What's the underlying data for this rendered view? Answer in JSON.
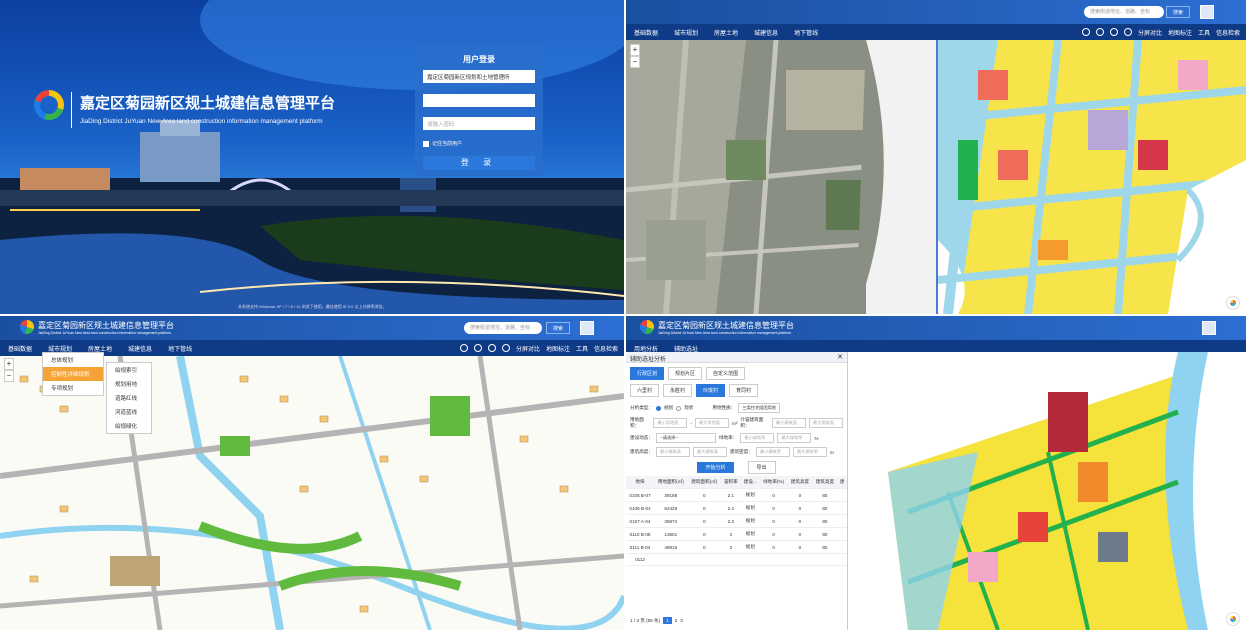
{
  "login": {
    "title_cn": "嘉定区菊园新区规土城建信息管理平台",
    "title_en": "JiaDing District JuYuan New Area land construction information management platform",
    "panel_title": "用户登录",
    "org_select": "嘉定区菊园新区规划和土地管理所",
    "user_select": "",
    "password_placeholder": "请输入密码",
    "remember": "记住当前用户",
    "login_button": "登 录",
    "footer": "本系统支持 Windows XP / 7 / 8 / 10 浏览下使用，最佳使用 IE 9.0 以上分辨率浏览。"
  },
  "app": {
    "title": "嘉定区菊园新区规土城建信息管理平台",
    "subtitle": "JiaDing District JuYuan New Area land construction information management platform",
    "search_placeholder": "搜索街道地址、道路、坐标",
    "search_button": "搜索",
    "menu": [
      "基础数据",
      "城市规划",
      "房屋土地",
      "城建信息",
      "地下管线"
    ],
    "right_menu": [
      "分屏对比",
      "地图标注",
      "工具",
      "信息检索"
    ],
    "q4_menu": [
      "用地分析",
      "辅助选址"
    ]
  },
  "dropdown": {
    "level1": [
      "总体规划",
      "控制性详细规划",
      "专项规划"
    ],
    "level2": [
      "绘规索引",
      "规划用地",
      "道路红线",
      "河道蓝线",
      "绘规绿化"
    ]
  },
  "panel": {
    "title": "辅助选址分析",
    "tabs1": [
      "行政区划",
      "规划片区",
      "自定义范围"
    ],
    "tabs2": [
      "六里村",
      "永胜村",
      "玲珑村",
      "育同村"
    ],
    "analysis_type_label": "分析类型：",
    "type_plan": "规划",
    "type_current": "现状",
    "land_use_label": "用地性质：",
    "land_use_value": "三类住宅组团用地",
    "area_label": "用地面积：",
    "min_area": "最小用地面",
    "max_area": "最大用地面",
    "unit_m2": "m²",
    "far_label": "计容建筑面积：",
    "min_far": "最小建筑面",
    "max_far": "最大建筑面",
    "status_label": "建设动态：",
    "status_value": "--请选择--",
    "green_label": "绿地率：",
    "min_green": "最小绿地率",
    "max_green": "最大绿地率",
    "pct": "%",
    "height_label": "建筑高度：",
    "min_height": "最小建筑高",
    "max_height": "最大建筑高",
    "density_label": "建筑密度：",
    "min_density": "最小建筑密",
    "max_density": "最大建筑密",
    "unit_m": "m",
    "start_button": "开始分析",
    "export_button": "导出",
    "columns": [
      "地块",
      "用地面积(㎡)",
      "建筑面积(㎡)",
      "容积率",
      "建设...",
      "绿地率(%)",
      "建筑高度",
      "建筑高度",
      "建"
    ],
    "rows": [
      [
        "0105 B-07",
        "39168",
        "0",
        "2.1",
        "规划",
        "0",
        "0",
        "80",
        ""
      ],
      [
        "0106 B-04",
        "62428",
        "0",
        "2.2",
        "规划",
        "0",
        "0",
        "80",
        ""
      ],
      [
        "0107 A-04",
        "35872",
        "0",
        "2.2",
        "规划",
        "0",
        "0",
        "80",
        ""
      ],
      [
        "0110 B-08",
        "13801",
        "0",
        "2",
        "规划",
        "0",
        "0",
        "80",
        ""
      ],
      [
        "0111 B-04",
        "48915",
        "0",
        "2",
        "规划",
        "0",
        "0",
        "80",
        ""
      ],
      [
        "0112",
        "",
        "",
        "",
        "",
        "",
        "",
        "",
        ""
      ]
    ],
    "pager": "1 / 3 页 (59 条)",
    "pages": [
      "1",
      "2",
      "3"
    ]
  },
  "colors": {
    "blue": "#2a78dc",
    "residential": "#f5e23a",
    "commercial": "#e8433a",
    "green": "#23b14d",
    "water": "#8fd3f1",
    "road": "#bfe6f5"
  }
}
